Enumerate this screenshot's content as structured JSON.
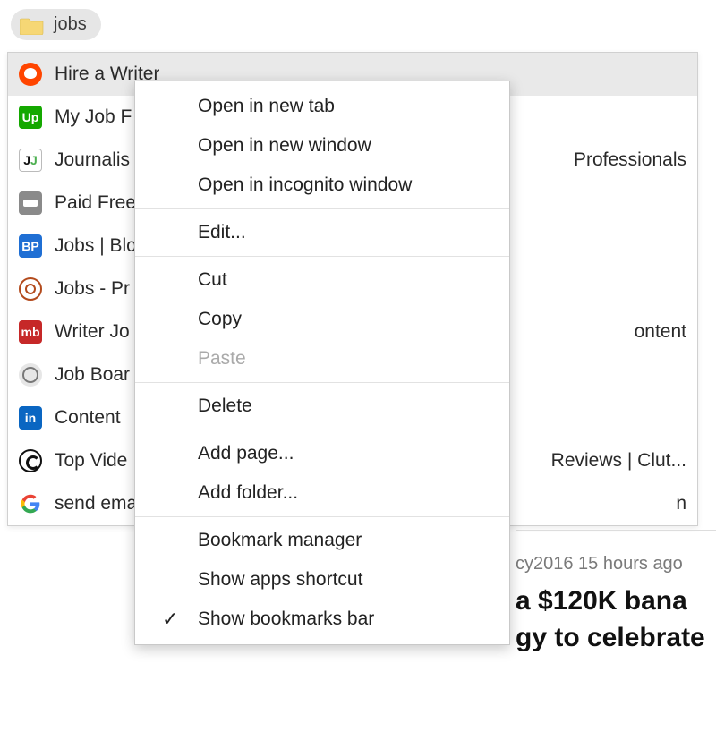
{
  "folder": {
    "name": "jobs"
  },
  "bookmarks": [
    {
      "icon": "reddit",
      "name": "hire-a-writer",
      "label_main": "Hire a Writer",
      "label_tail": "",
      "hovered": true
    },
    {
      "icon": "upwork",
      "name": "my-job-feed",
      "label_main": "My Job F",
      "label_tail": ""
    },
    {
      "icon": "jj",
      "name": "journalism-jobs",
      "label_main": "Journalis",
      "label_tail": "Professionals"
    },
    {
      "icon": "paid",
      "name": "paid-freelance",
      "label_main": "Paid Free",
      "label_tail": ""
    },
    {
      "icon": "bp",
      "name": "jobs-blogging",
      "label_main": "Jobs | Blo",
      "label_tail": ""
    },
    {
      "icon": "pro",
      "name": "jobs-problogger",
      "label_main": "Jobs - Pr",
      "label_tail": ""
    },
    {
      "icon": "mb",
      "name": "writer-jobs",
      "label_main": "Writer Jo",
      "label_tail": "ontent"
    },
    {
      "icon": "board",
      "name": "job-board",
      "label_main": "Job Boar",
      "label_tail": ""
    },
    {
      "icon": "linkedin",
      "name": "content-linkedin",
      "label_main": "Content",
      "label_tail": ""
    },
    {
      "icon": "clutch",
      "name": "top-video-clutch",
      "label_main": "Top Vide",
      "label_tail": "Reviews | Clut..."
    },
    {
      "icon": "google",
      "name": "send-email-search",
      "label_main": "send ema",
      "label_tail": "n"
    }
  ],
  "context_menu": {
    "groups": [
      [
        {
          "label": "Open in new tab",
          "enabled": true
        },
        {
          "label": "Open in new window",
          "enabled": true
        },
        {
          "label": "Open in incognito window",
          "enabled": true
        }
      ],
      [
        {
          "label": "Edit...",
          "enabled": true
        }
      ],
      [
        {
          "label": "Cut",
          "enabled": true
        },
        {
          "label": "Copy",
          "enabled": true
        },
        {
          "label": "Paste",
          "enabled": false
        }
      ],
      [
        {
          "label": "Delete",
          "enabled": true
        }
      ],
      [
        {
          "label": "Add page...",
          "enabled": true
        },
        {
          "label": "Add folder...",
          "enabled": true
        }
      ],
      [
        {
          "label": "Bookmark manager",
          "enabled": true
        },
        {
          "label": "Show apps shortcut",
          "enabled": true
        },
        {
          "label": "Show bookmarks bar",
          "enabled": true,
          "checked": true
        }
      ]
    ]
  },
  "page_behind": {
    "meta": "cy2016 15 hours ago",
    "title_lines": [
      "a $120K bana",
      "gy to celebrate"
    ]
  }
}
